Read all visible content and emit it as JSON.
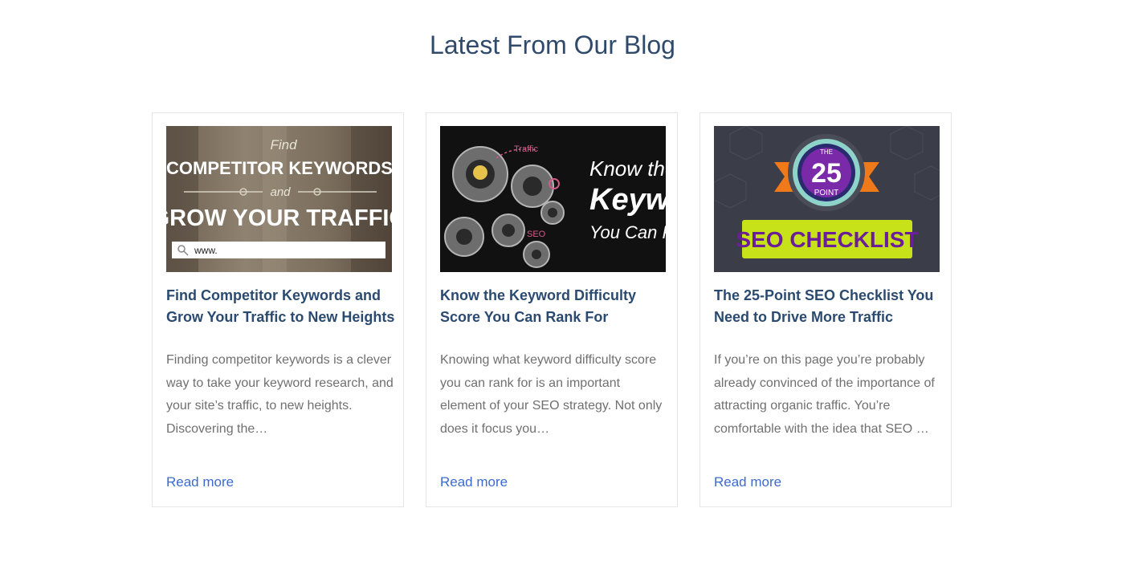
{
  "section": {
    "title": "Latest From Our Blog"
  },
  "posts": [
    {
      "image_alt": "Find Competitor Keywords and Grow Your Traffic banner",
      "image_text": {
        "line1": "Find",
        "line2": "COMPETITOR KEYWORDS",
        "line3": "and",
        "line4": "GROW YOUR TRAFFIC",
        "search": "www."
      },
      "title": "Find Competitor Keywords and Grow Your Traffic to New Heights",
      "excerpt": "Finding competitor keywords is a clever way to take your keyword research, and your site’s traffic, to new heights. Discovering the…",
      "read_more": "Read more"
    },
    {
      "image_alt": "Know the Keyword Difficulty Score banner with gears",
      "image_text": {
        "line1": "Know the",
        "line2": "Keyw",
        "line3": "You Can R",
        "traffic": "Traffic",
        "seo": "SEO"
      },
      "title": "Know the Keyword Difficulty Score You Can Rank For",
      "excerpt": "Knowing what keyword difficulty score you can rank for is an important element of your SEO strategy. Not only does it focus you…",
      "read_more": "Read more"
    },
    {
      "image_alt": "The 25-Point SEO Checklist badge",
      "image_text": {
        "the": "THE",
        "number": "25",
        "point": "POINT",
        "banner": "SEO CHECKLIST"
      },
      "title": "The 25-Point SEO Checklist You Need to Drive More Traffic",
      "excerpt": "If you’re on this page you’re probably already convinced of the importance of attracting organic traffic. You’re comfortable with the idea that SEO …",
      "read_more": "Read more"
    }
  ],
  "colors": {
    "title": "#2f4a6b",
    "post_title": "#2b4a70",
    "excerpt": "#707070",
    "link": "#3c6bd0",
    "card_border": "#e6e6e6"
  }
}
